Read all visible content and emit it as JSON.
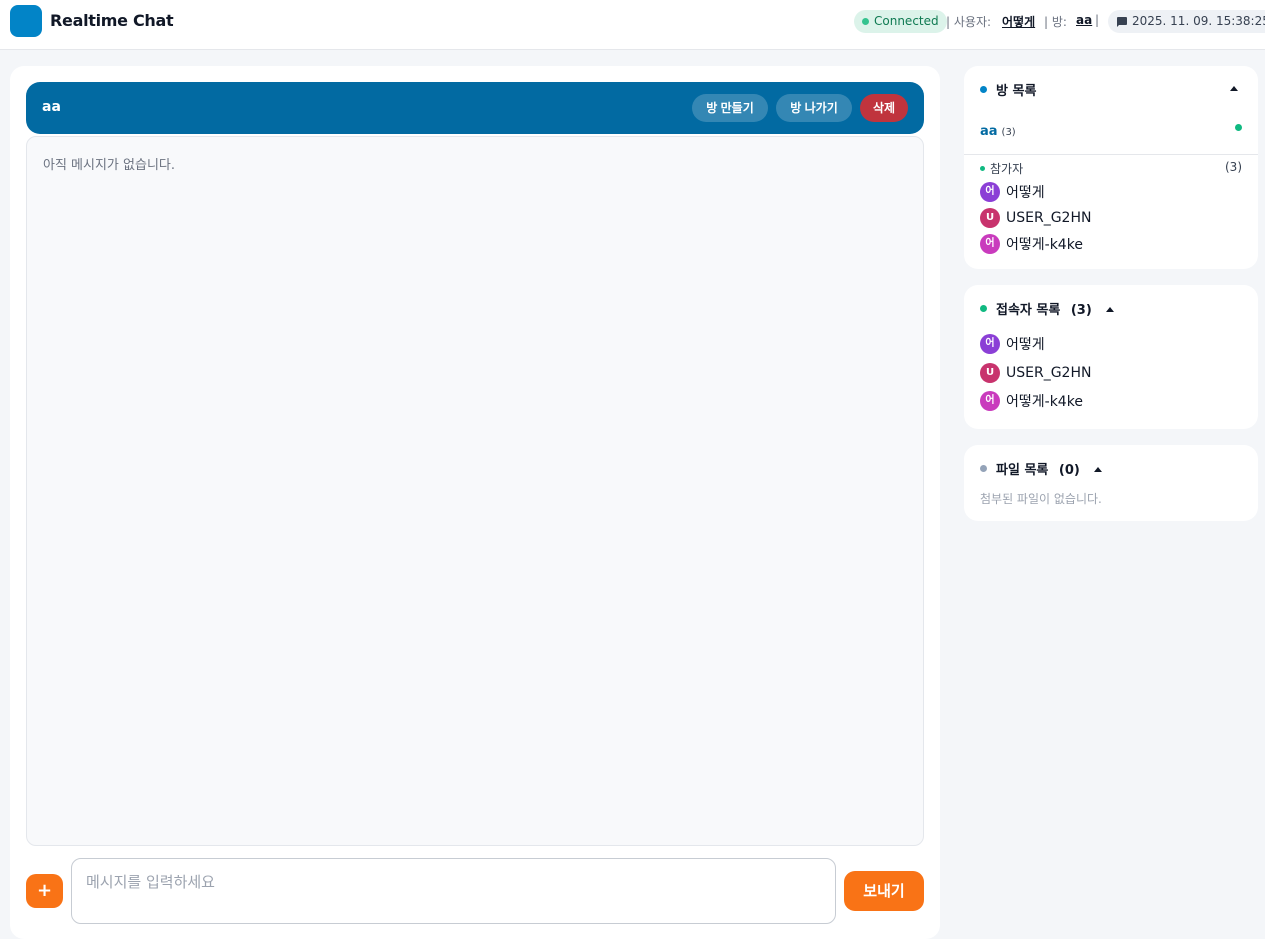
{
  "app": {
    "title": "Realtime Chat"
  },
  "header": {
    "status": "Connected",
    "user_label": "| 사용자:",
    "user_name": "어떻게",
    "room_label": "| 방:",
    "room_name": "aa",
    "sep": "|",
    "datetime": "2025. 11. 09. 15:38:25"
  },
  "room": {
    "name": "aa",
    "create_label": "방 만들기",
    "leave_label": "방 나가기",
    "delete_label": "삭제"
  },
  "messages": {
    "empty": "아직 메시지가 없습니다."
  },
  "composer": {
    "attach_label": "+",
    "placeholder": "메시지를 입력하세요",
    "send_label": "보내기"
  },
  "room_list": {
    "title": "방 목록",
    "rooms": [
      {
        "name": "aa",
        "count": "(3)"
      }
    ],
    "participants_label": "참가자",
    "participants_count": "(3)",
    "participants": [
      {
        "initial": "어",
        "name": "어떻게",
        "color": "#8b3fd6"
      },
      {
        "initial": "U",
        "name": "USER_G2HN",
        "color": "#c8336d"
      },
      {
        "initial": "어",
        "name": "어떻게-k4ke",
        "color": "#c93bbd"
      }
    ]
  },
  "users_list": {
    "title": "접속자 목록",
    "count": "(3)",
    "users": [
      {
        "initial": "어",
        "name": "어떻게",
        "color": "#8b3fd6"
      },
      {
        "initial": "U",
        "name": "USER_G2HN",
        "color": "#c8336d"
      },
      {
        "initial": "어",
        "name": "어떻게-k4ke",
        "color": "#c93bbd"
      }
    ]
  },
  "files_list": {
    "title": "파일 목록",
    "count": "(0)",
    "empty": "첨부된 파일이 없습니다."
  },
  "colors": {
    "brand": "#0284c7",
    "room_header": "#026aa2",
    "accent": "#f97316",
    "danger": "#c0343d",
    "online": "#10b981"
  },
  "icons": {
    "date": "chat-bubble-icon",
    "collapse": "caret-up-icon"
  }
}
